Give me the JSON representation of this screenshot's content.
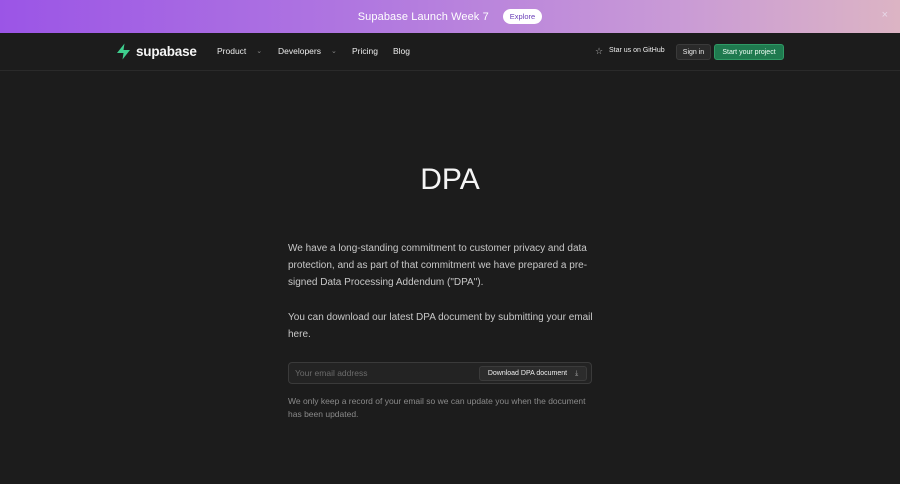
{
  "banner": {
    "text": "Supabase Launch Week 7",
    "button": "Explore",
    "close": "×"
  },
  "nav": {
    "brand": "supabase",
    "items": [
      {
        "label": "Product",
        "dropdown": true
      },
      {
        "label": "Developers",
        "dropdown": true
      },
      {
        "label": "Pricing",
        "dropdown": false
      },
      {
        "label": "Blog",
        "dropdown": false
      }
    ],
    "github": "Star us on GitHub",
    "signin": "Sign in",
    "start": "Start your project"
  },
  "page": {
    "title": "DPA",
    "para1": "We have a long-standing commitment to customer privacy and data protection, and as part of that commitment we have prepared a pre-signed Data Processing Addendum (\"DPA\").",
    "para2": "You can download our latest DPA document by submitting your email here.",
    "email_placeholder": "Your email address",
    "download_button": "Download DPA document",
    "note": "We only keep a record of your email so we can update you when the document has been updated."
  },
  "colors": {
    "brand_green": "#3ecf8e",
    "accent_button": "#1f7a4f",
    "banner_purple": "#9b55e6"
  },
  "icons": [
    "supabase-logo-icon",
    "chevron-down-icon",
    "star-icon",
    "download-icon",
    "close-icon"
  ]
}
